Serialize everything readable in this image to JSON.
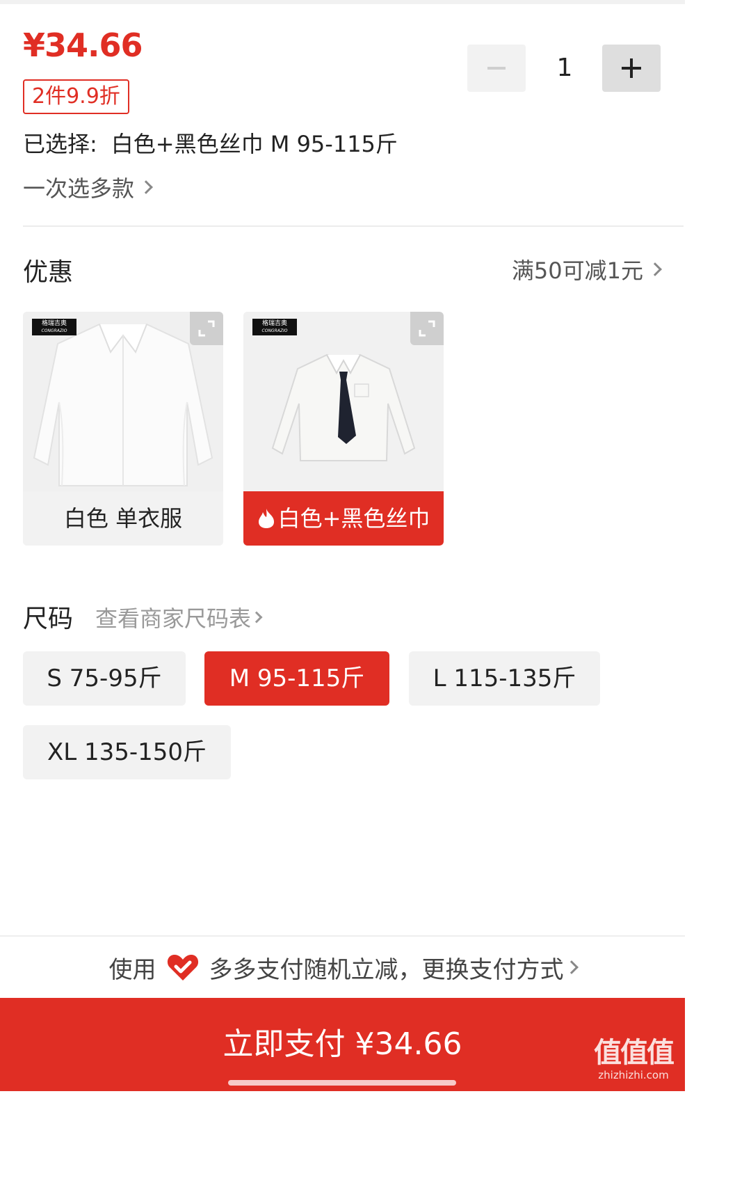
{
  "product": {
    "price": "¥34.66",
    "discount_tag": "2件9.9折",
    "quantity": "1",
    "selected_label": "已选择:",
    "selected_value": "白色+黑色丝巾 M 95-115斤",
    "multi_select": "一次选多款"
  },
  "promo": {
    "title": "优惠",
    "link": "满50可减1元"
  },
  "variants": [
    {
      "label": "白色 单衣服",
      "selected": false,
      "brand": "格瑞吉奥",
      "brand_sub": "CONGRAZIO"
    },
    {
      "label": "白色+黑色丝巾",
      "selected": true,
      "brand": "格瑞吉奥",
      "brand_sub": "CONGRAZIO"
    }
  ],
  "size": {
    "title": "尺码",
    "chart_link": "查看商家尺码表",
    "options": [
      {
        "label": "S 75-95斤",
        "selected": false
      },
      {
        "label": "M 95-115斤",
        "selected": true
      },
      {
        "label": "L 115-135斤",
        "selected": false
      },
      {
        "label": "XL 135-150斤",
        "selected": false
      }
    ]
  },
  "payment": {
    "prefix": "使用",
    "method_text": "多多支付随机立减，更换支付方式",
    "pay_button": "立即支付 ¥34.66"
  },
  "watermark": {
    "big": "值值值",
    "small": "zhizhizhi.com"
  },
  "colors": {
    "accent": "#e02e24",
    "chip_bg": "#f2f2f2"
  }
}
